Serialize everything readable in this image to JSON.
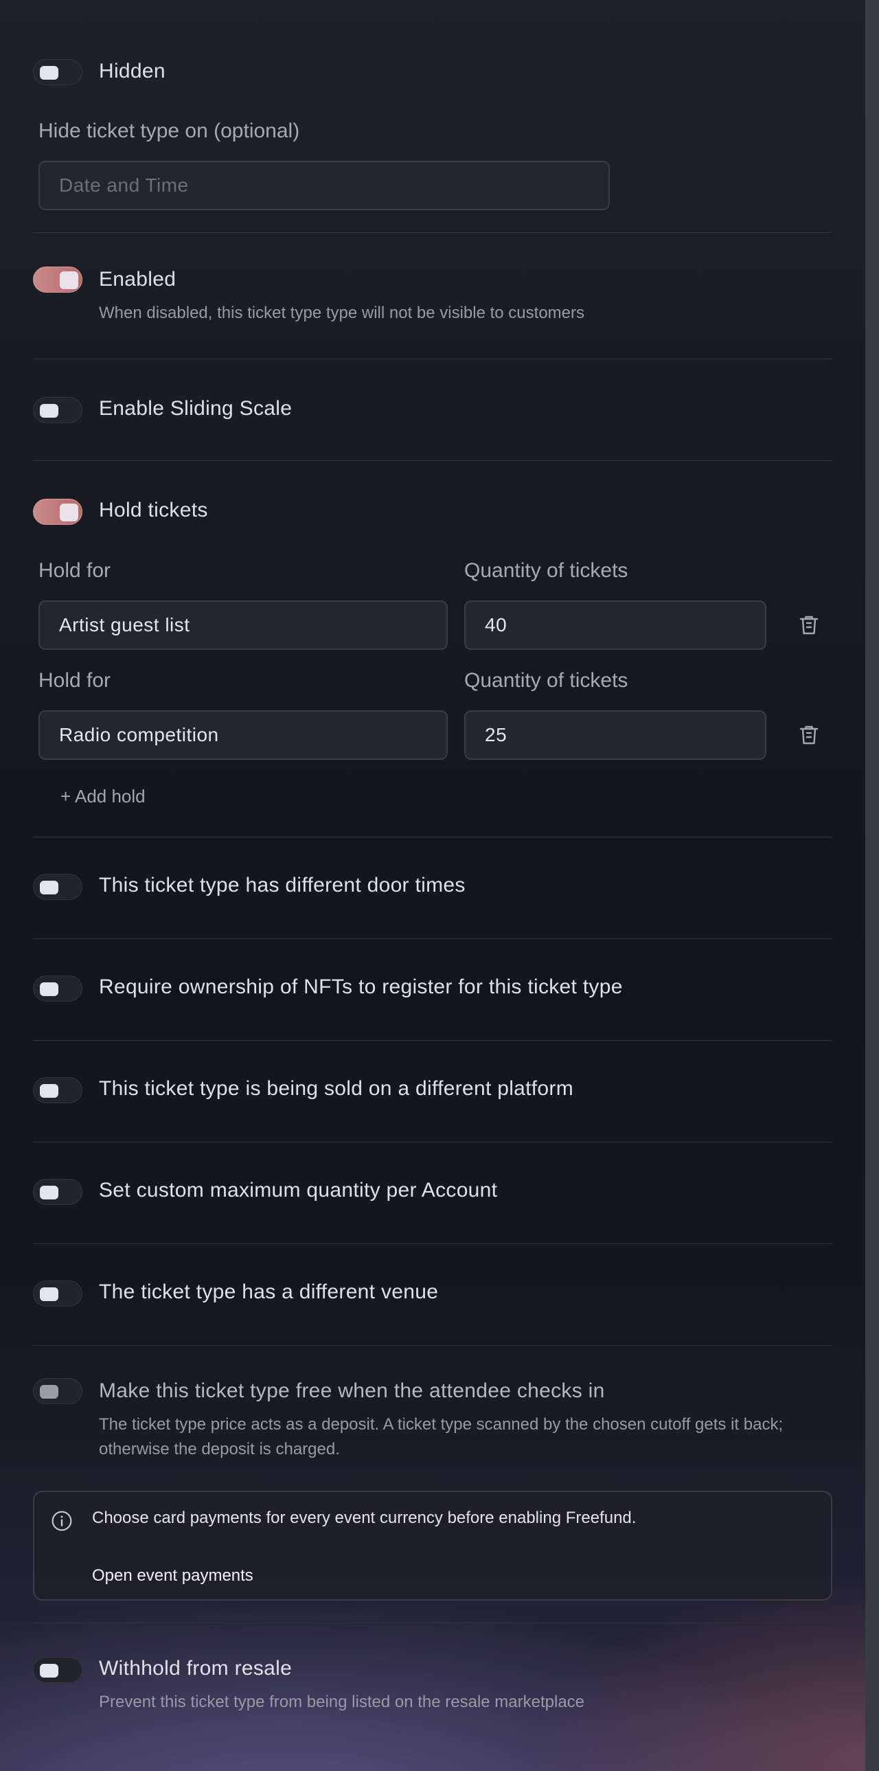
{
  "hidden": {
    "label": "Hidden"
  },
  "hide_on": {
    "label": "Hide ticket type on (optional)",
    "placeholder": "Date and Time",
    "value": ""
  },
  "enabled": {
    "label": "Enabled",
    "description": "When disabled, this ticket type type will not be visible to customers"
  },
  "sliding_scale": {
    "label": "Enable Sliding Scale"
  },
  "hold_tickets": {
    "label": "Hold tickets",
    "holds": [
      {
        "hold_for_label": "Hold for",
        "hold_for_value": "Artist guest list",
        "quantity_label": "Quantity of tickets",
        "quantity_value": "40"
      },
      {
        "hold_for_label": "Hold for",
        "hold_for_value": "Radio competition",
        "quantity_label": "Quantity of tickets",
        "quantity_value": "25"
      }
    ],
    "add_hold_label": "+ Add hold"
  },
  "door_times": {
    "label": "This ticket type has different door times"
  },
  "nft": {
    "label": "Require ownership of NFTs to register for this ticket type"
  },
  "different_platform": {
    "label": "This ticket type is being sold on a different platform"
  },
  "custom_max": {
    "label": "Set custom maximum quantity per Account"
  },
  "different_venue": {
    "label": "The ticket type has a different venue"
  },
  "freefund": {
    "label": "Make this ticket type free when the attendee checks in",
    "description_line1": "The ticket type price acts as a deposit. A ticket type scanned by the chosen cutoff gets it back;",
    "description_line2": "otherwise the deposit is charged."
  },
  "notice": {
    "message": "Choose card payments for every event currency before enabling Freefund.",
    "link": "Open event payments"
  },
  "withhold_resale": {
    "label": "Withhold from resale",
    "description": "Prevent this ticket type from being listed on the resale marketplace"
  },
  "colors": {
    "toggle_on": "#c27c80",
    "background": "#16171d",
    "divider": "#2f313b"
  },
  "toggles_state": {
    "hidden": false,
    "enabled": true,
    "sliding_scale": false,
    "hold_tickets": true,
    "door_times": false,
    "nft": false,
    "different_platform": false,
    "custom_max": false,
    "different_venue": false,
    "freefund": false,
    "withhold_resale": false
  }
}
